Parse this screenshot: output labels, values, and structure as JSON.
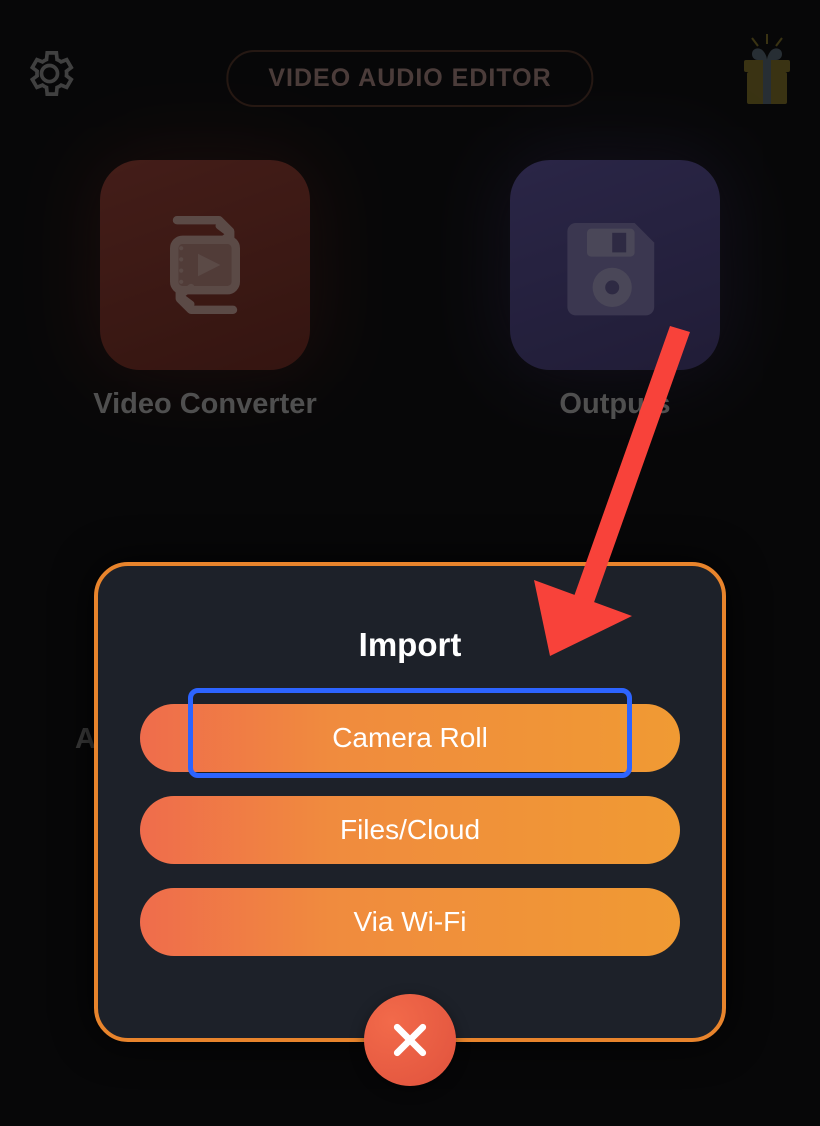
{
  "header": {
    "title": "VIDEO AUDIO EDITOR"
  },
  "tiles": {
    "video_converter": "Video Converter",
    "outputs": "Outputs"
  },
  "background": {
    "left_partial": "A"
  },
  "modal": {
    "title": "Import",
    "options": {
      "camera_roll": "Camera Roll",
      "files_cloud": "Files/Cloud",
      "via_wifi": "Via Wi-Fi"
    }
  }
}
